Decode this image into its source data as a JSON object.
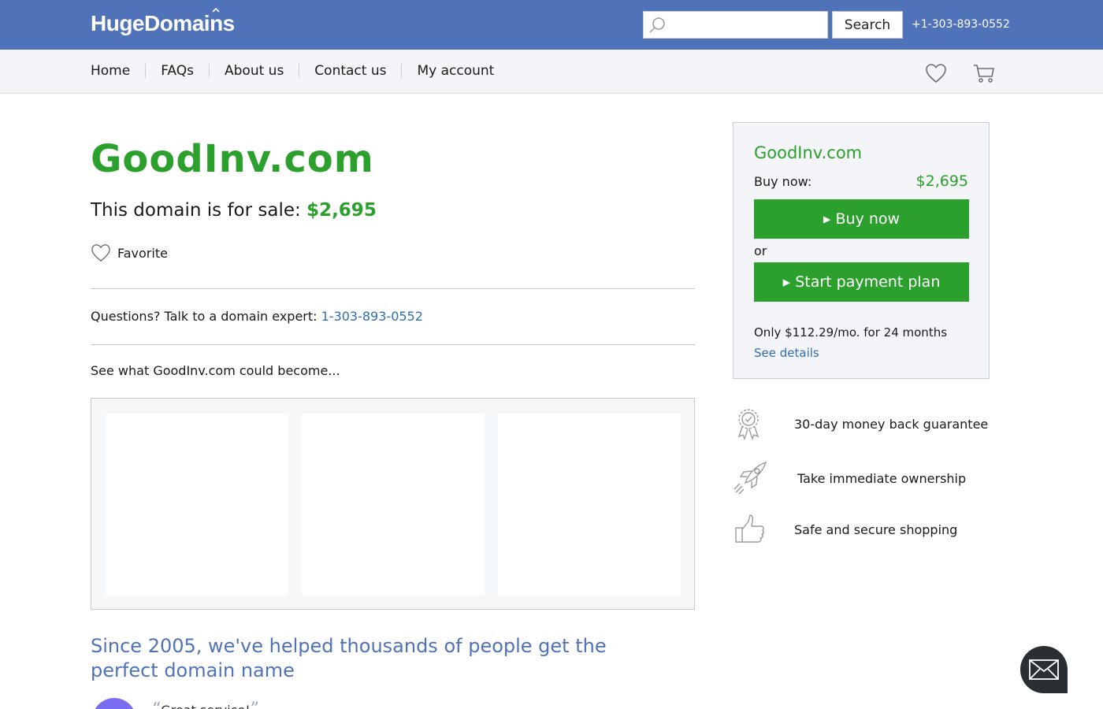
{
  "header": {
    "logo": "HugeDomains",
    "search_placeholder": "",
    "search_button": "Search",
    "phone": "+1-303-893-0552"
  },
  "nav": {
    "items": [
      "Home",
      "FAQs",
      "About us",
      "Contact us",
      "My account"
    ]
  },
  "main": {
    "domain": "GoodInv.com",
    "for_sale_prefix": "This domain is for sale: ",
    "price": "$2,695",
    "favorite_label": "Favorite",
    "questions_prefix": "Questions? Talk to a domain expert: ",
    "questions_phone": "1-303-893-0552",
    "become_text": "See what GoodInv.com could become...",
    "since_text": "Since 2005, we've helped thousands of people get the perfect domain name",
    "testimonial_text": "Great service!"
  },
  "buybox": {
    "domain": "GoodInv.com",
    "buy_now_label": "Buy now:",
    "price": "$2,695",
    "buy_button": "▸ Buy now",
    "or_text": "or",
    "plan_button": "▸ Start payment plan",
    "monthly_text": "Only $112.29/mo. for 24 months",
    "details_link": "See details"
  },
  "features": [
    {
      "icon": "award-ribbon-icon",
      "text": "30-day money back guarantee"
    },
    {
      "icon": "rocket-icon",
      "text": "Take immediate ownership"
    },
    {
      "icon": "thumbs-up-icon",
      "text": "Safe and secure shopping"
    }
  ],
  "colors": {
    "header_blue": "#4f72b8",
    "accent_green": "#2ca02c",
    "link_blue": "#2f6db5"
  }
}
